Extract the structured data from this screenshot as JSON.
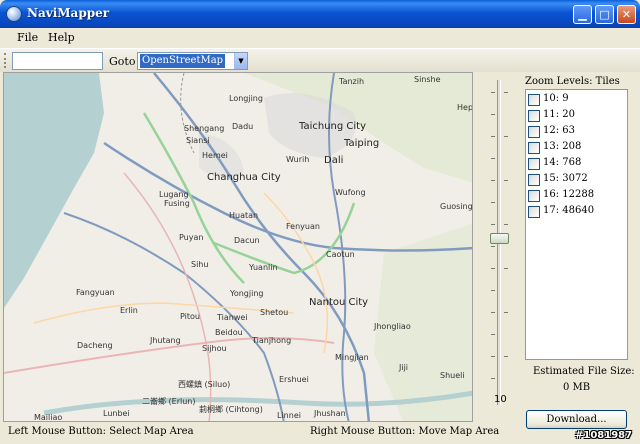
{
  "window": {
    "title": "NaviMapper"
  },
  "menu": {
    "items": [
      {
        "label": "File"
      },
      {
        "label": "Help"
      }
    ]
  },
  "toolbar": {
    "address_value": "",
    "goto_label": "Goto",
    "source_selected": "OpenStreetMap"
  },
  "map": {
    "places": [
      "Tanzih",
      "Sinshe",
      "Hepi",
      "Longjing",
      "Dadu",
      "Shengang",
      "Siansi",
      "Taichung City",
      "Taiping",
      "Hemei",
      "Wurih",
      "Dali",
      "Changhua City",
      "Wufong",
      "Lugang",
      "Fusing",
      "Guosing",
      "Huatan",
      "Fenyuan",
      "Puyan",
      "Dacun",
      "Caotun",
      "Sihu",
      "Yuanlin",
      "Fangyuan",
      "Yongjing",
      "Nantou City",
      "Erlin",
      "Pitou",
      "Shetou",
      "Tianwei",
      "Jhongliao",
      "Dacheng",
      "Jhutang",
      "Beidou",
      "Tianjhong",
      "Sijhou",
      "Mingjian",
      "Jiji",
      "Ershuei",
      "Shueli",
      "二崙鄉 (Erlun)",
      "西螺鎮 (Siluo)",
      "莿桐鄉 (Cihtong)",
      "Mailiao",
      "Lunbei",
      "Linnei",
      "Jhushan"
    ]
  },
  "zoom_slider": {
    "bottom_label": "10",
    "level_fraction": 0.5
  },
  "side": {
    "zoom_title": "Zoom Levels: Tiles",
    "levels": [
      {
        "label": "10: 9",
        "checked": false
      },
      {
        "label": "11: 20",
        "checked": false
      },
      {
        "label": "12: 63",
        "checked": false
      },
      {
        "label": "13: 208",
        "checked": false
      },
      {
        "label": "14: 768",
        "checked": false
      },
      {
        "label": "15: 3072",
        "checked": false
      },
      {
        "label": "16: 12288",
        "checked": false
      },
      {
        "label": "17: 48640",
        "checked": false
      }
    ],
    "estimated_label": "Estimated File Size:",
    "estimated_value": "0 MB",
    "download_label": "Download..."
  },
  "status": {
    "left": "Left Mouse Button: Select Map Area",
    "right": "Right Mouse Button: Move Map Area"
  },
  "watermark": "#1081987",
  "colors": {
    "titlebar": "#0a54d2",
    "sea": "#b5d0d0",
    "land": "#f1eee8",
    "motorway": "#809bc0",
    "primary": "#e9b5b5",
    "trunk": "#97d397"
  }
}
